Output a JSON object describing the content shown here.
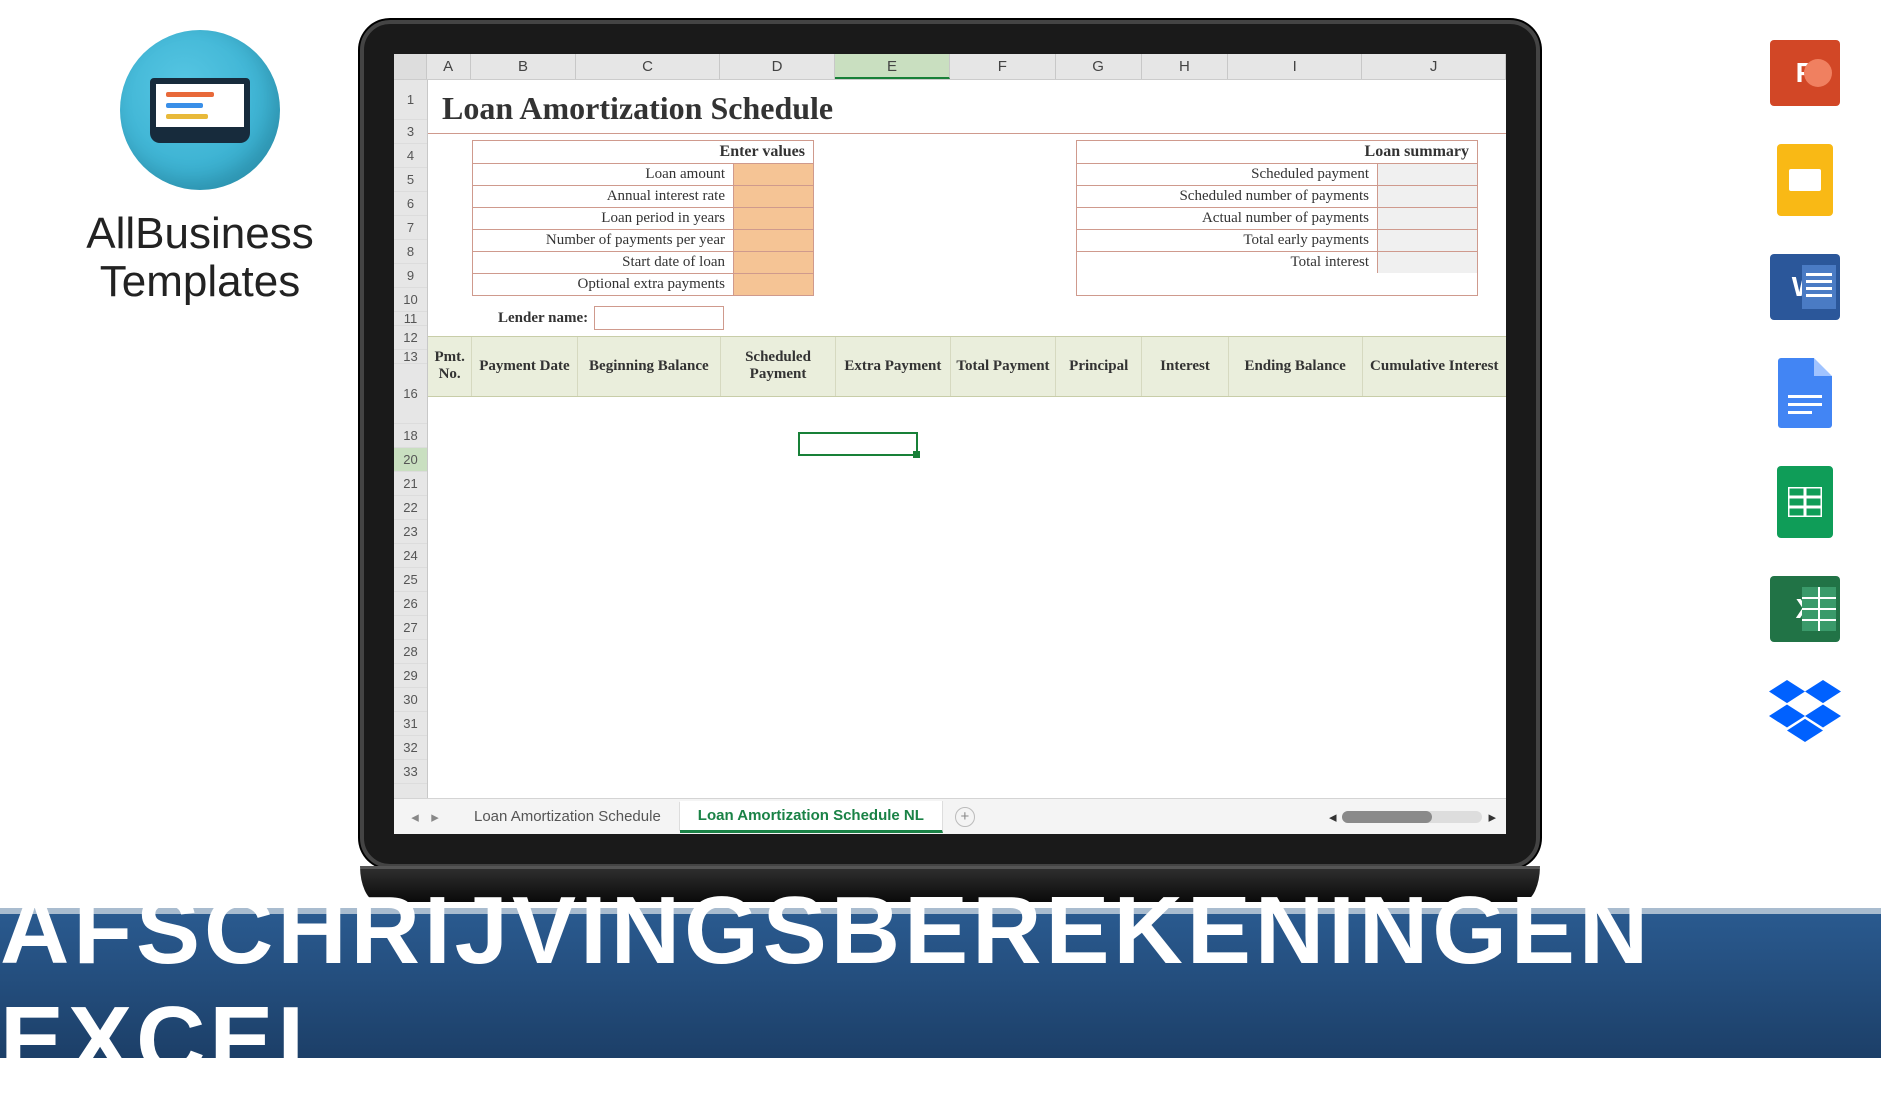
{
  "logo": {
    "line1": "AllBusiness",
    "line2": "Templates"
  },
  "excel": {
    "columns": [
      "A",
      "B",
      "C",
      "D",
      "E",
      "F",
      "G",
      "H",
      "I",
      "J"
    ],
    "rows": [
      "1",
      "3",
      "4",
      "5",
      "6",
      "7",
      "8",
      "9",
      "10",
      "11",
      "12",
      "13",
      "16",
      "18",
      "20",
      "21",
      "22",
      "23",
      "24",
      "25",
      "26",
      "27",
      "28",
      "29",
      "30",
      "31",
      "32",
      "33"
    ],
    "title": "Loan Amortization Schedule",
    "enter": {
      "header": "Enter values",
      "items": [
        "Loan amount",
        "Annual interest rate",
        "Loan period in years",
        "Number of payments per year",
        "Start date of loan",
        "Optional extra payments"
      ]
    },
    "summary": {
      "header": "Loan summary",
      "items": [
        "Scheduled payment",
        "Scheduled number of payments",
        "Actual number of payments",
        "Total early payments",
        "Total interest"
      ]
    },
    "lender": "Lender name:",
    "schedule_headers": [
      "Pmt. No.",
      "Payment Date",
      "Beginning Balance",
      "Scheduled Payment",
      "Extra Payment",
      "Total Payment",
      "Principal",
      "Interest",
      "Ending Balance",
      "Cumulative Interest"
    ],
    "tabs": {
      "t1": "Loan Amortization Schedule",
      "t2": "Loan Amortization Schedule NL"
    }
  },
  "footer": "AFSCHRIJVINGSBEREKENINGEN EXCEL",
  "apps": {
    "powerpoint": "P",
    "slides": "",
    "word": "W",
    "docs": "",
    "sheets": "",
    "excel": "X",
    "dropbox": ""
  }
}
